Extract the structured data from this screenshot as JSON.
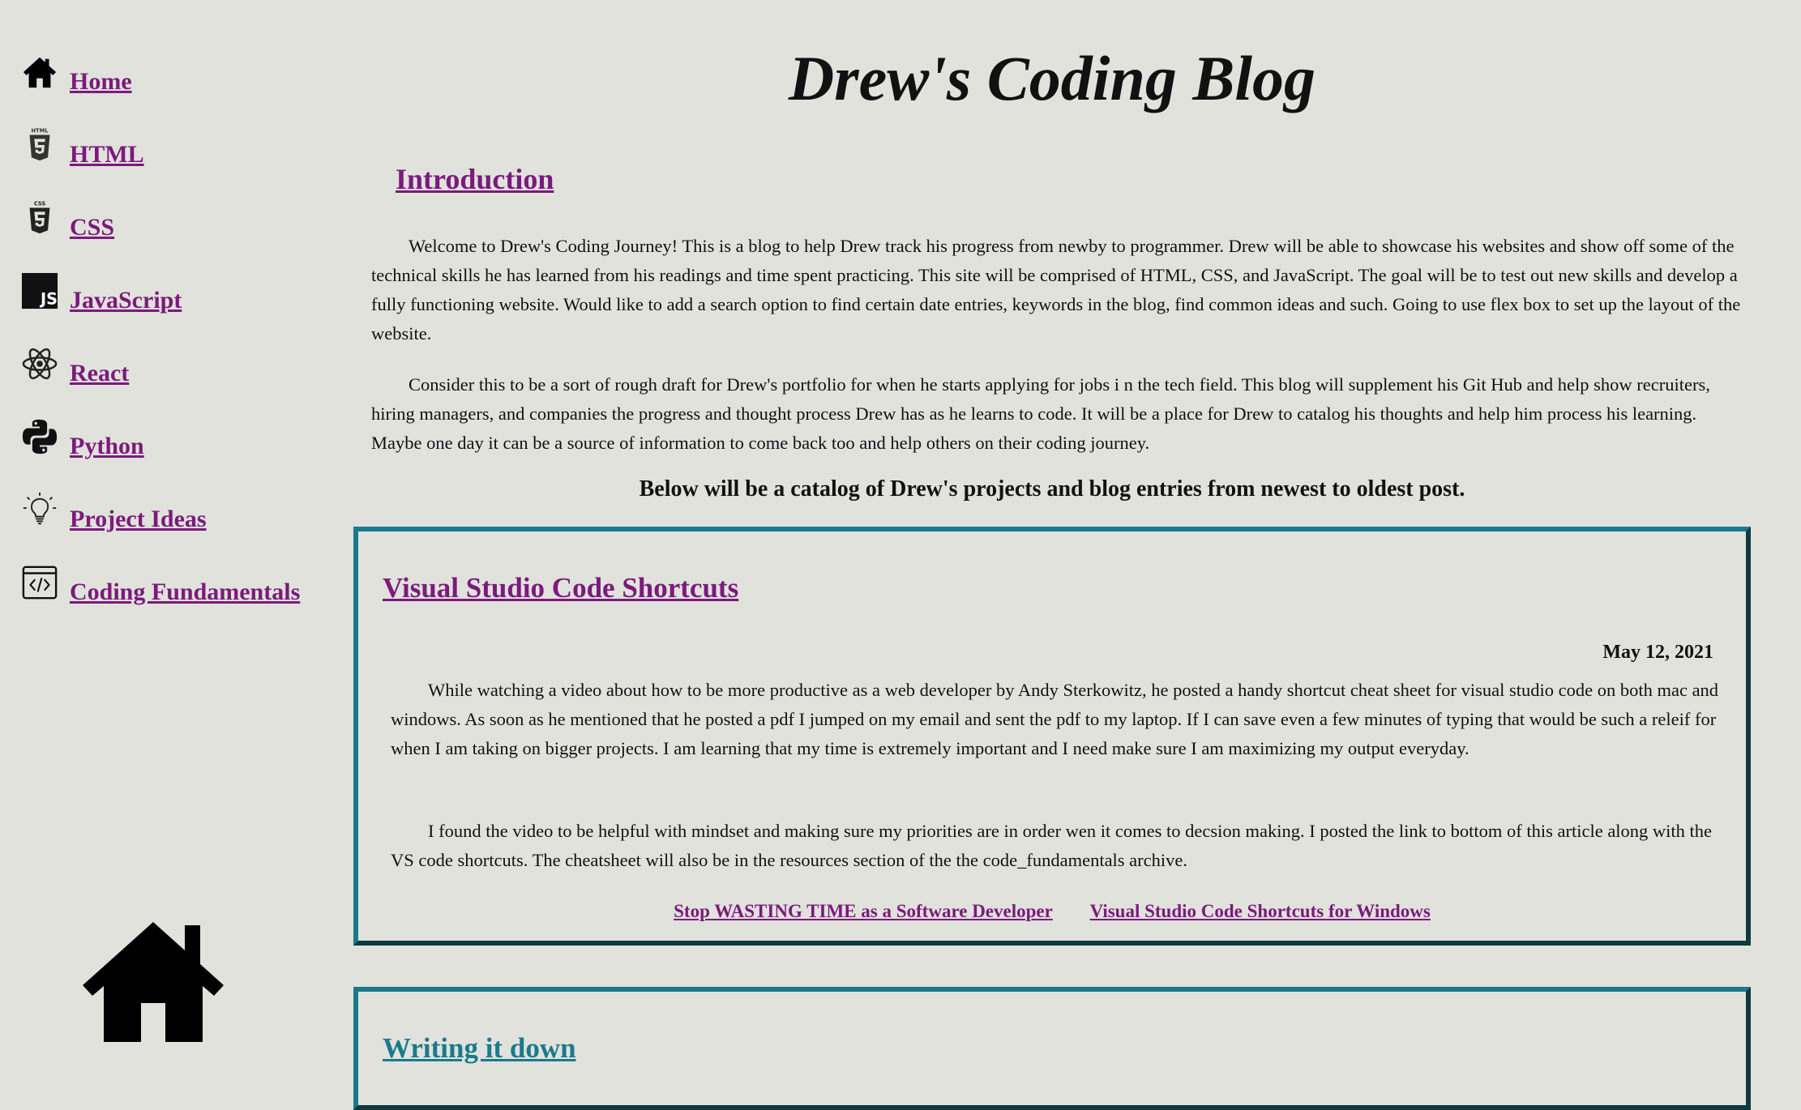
{
  "sidebar": {
    "items": [
      {
        "label": "Home",
        "icon": "home-icon"
      },
      {
        "label": "HTML",
        "icon": "html5-icon"
      },
      {
        "label": "CSS",
        "icon": "css3-icon"
      },
      {
        "label": "JavaScript",
        "icon": "javascript-icon"
      },
      {
        "label": "React",
        "icon": "react-icon"
      },
      {
        "label": "Python",
        "icon": "python-icon"
      },
      {
        "label": "Project Ideas",
        "icon": "lightbulb-icon"
      },
      {
        "label": "Coding Fundamentals",
        "icon": "code-window-icon"
      }
    ]
  },
  "header": {
    "title": "Drew's Coding Blog"
  },
  "intro": {
    "heading": "Introduction",
    "p1": "Welcome to Drew's Coding Journey! This is a blog to help Drew track his progress from newby to programmer. Drew will be able to showcase his websites and show off some of the technical skills he has learned from his readings and time spent practicing. This site will be comprised of HTML, CSS, and JavaScript. The goal will be to test out new skills and develop a fully functioning website. Would like to add a search option to find certain date entries, keywords in the blog, find common ideas and such. Going to use flex box to set up the layout of the website.",
    "p2": "Consider this to be a sort of rough draft for Drew's portfolio for when he starts applying for jobs i n the tech field. This blog will supplement his Git Hub and help show recruiters, hiring managers, and companies the progress and thought process Drew has as he learns to code. It will be a place for Drew to catalog his thoughts and help him process his learning. Maybe one day it can be a source of information to come back too and help others on their coding journey.",
    "catalog_note": "Below will be a catalog of Drew's projects and blog entries from newest to oldest post."
  },
  "posts": [
    {
      "title": "Visual Studio Code Shortcuts",
      "date": "May 12, 2021",
      "p1": "While watching a video about how to be more productive as a web developer by Andy Sterkowitz, he posted a handy shortcut cheat sheet for visual studio code on both mac and windows. As soon as he mentioned that he posted a pdf I jumped on my email and sent the pdf to my laptop. If I can save even a few minutes of typing that would be such a releif for when I am taking on bigger projects. I am learning that my time is extremely important and I need make sure I am maximizing my output everyday.",
      "p2": "I found the video to be helpful with mindset and making sure my priorities are in order wen it comes to decsion making. I posted the link to bottom of this article along with the VS code shortcuts. The cheatsheet will also be in the resources section of the the code_fundamentals archive.",
      "links": [
        "Stop WASTING TIME as a Software Developer",
        "Visual Studio Code Shortcuts for Windows"
      ]
    },
    {
      "title": "Writing it down"
    }
  ],
  "colors": {
    "background": "#e1e2dc",
    "link": "#7b1a7d",
    "border_accent": "#1a7a8c",
    "border_dark": "#0e3a40"
  }
}
